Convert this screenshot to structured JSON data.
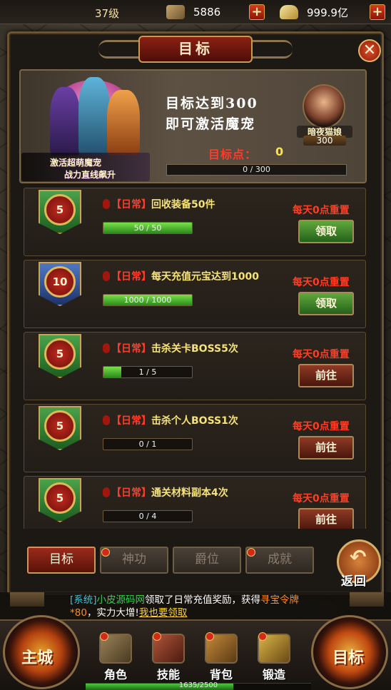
{
  "topbar": {
    "level": "37级",
    "resource1": {
      "icon": "gold-ingot-icon",
      "value": "5886"
    },
    "resource2": {
      "icon": "yuanbao-icon",
      "value": "999.9亿"
    },
    "plus_label": "+"
  },
  "panel": {
    "title": "目标",
    "close_label": "✕"
  },
  "banner": {
    "tag_line1": "激活超萌魔宠",
    "tag_line2": "战力直线飙升",
    "target_line1": "目标达到300",
    "target_line2": "即可激活魔宠",
    "points_label": "目标点：",
    "points_value": "0",
    "progress_text": "0 / 300",
    "progress_fraction": 0.0,
    "pet_name": "暗夜猫娘",
    "pet_points": "300"
  },
  "tasks": [
    {
      "badge_color": "green",
      "medal": "5",
      "tag": "【日常】",
      "title": "回收装备50件",
      "progress_text": "50 / 50",
      "progress_fraction": 1.0,
      "reset": "每天0点重置",
      "button": "领取",
      "button_type": "claim"
    },
    {
      "badge_color": "blue",
      "medal": "10",
      "tag": "【日常】",
      "title": "每天充值元宝达到1000",
      "progress_text": "1000 / 1000",
      "progress_fraction": 1.0,
      "reset": "每天0点重置",
      "button": "领取",
      "button_type": "claim"
    },
    {
      "badge_color": "green",
      "medal": "5",
      "tag": "【日常】",
      "title": "击杀关卡BOSS5次",
      "progress_text": "1 / 5",
      "progress_fraction": 0.2,
      "reset": "每天0点重置",
      "button": "前往",
      "button_type": "go"
    },
    {
      "badge_color": "green",
      "medal": "5",
      "tag": "【日常】",
      "title": "击杀个人BOSS1次",
      "progress_text": "0 / 1",
      "progress_fraction": 0.0,
      "reset": "每天0点重置",
      "button": "前往",
      "button_type": "go"
    },
    {
      "badge_color": "green",
      "medal": "5",
      "tag": "【日常】",
      "title": "通关材料副本4次",
      "progress_text": "0 / 4",
      "progress_fraction": 0.0,
      "reset": "每天0点重置",
      "button": "前往",
      "button_type": "go"
    }
  ],
  "tabs": [
    {
      "label": "目标",
      "active": true,
      "dot": false
    },
    {
      "label": "神功",
      "active": false,
      "dot": true
    },
    {
      "label": "爵位",
      "active": false,
      "dot": false
    },
    {
      "label": "成就",
      "active": false,
      "dot": true
    }
  ],
  "back": {
    "label": "返回",
    "arrow": "↶"
  },
  "chat": {
    "system": "[系统]",
    "name": "小皮源码网",
    "text1": "领取了日常充值奖励，获得",
    "item": "寻宝令牌*80",
    "text2": "，实力大增!",
    "link": "我也要领取"
  },
  "hud": {
    "city_label": "主城",
    "target_label": "目标",
    "menu": [
      {
        "label": "角色",
        "icon": "armor-icon",
        "dot": true
      },
      {
        "label": "技能",
        "icon": "skill-book-icon",
        "dot": true
      },
      {
        "label": "背包",
        "icon": "treasure-chest-icon",
        "dot": true
      },
      {
        "label": "锻造",
        "icon": "anvil-icon",
        "dot": true
      }
    ],
    "exp_text": "1635/2500",
    "exp_fraction": 0.654
  }
}
